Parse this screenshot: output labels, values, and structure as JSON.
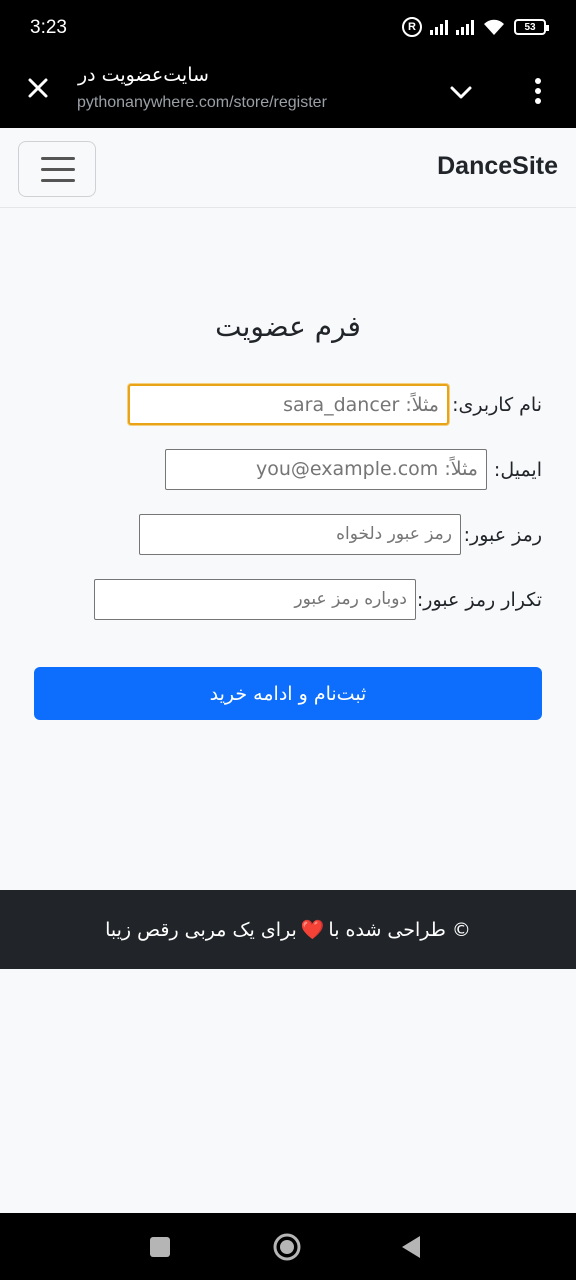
{
  "status_bar": {
    "time": "3:23",
    "battery": "53",
    "r_badge": "R"
  },
  "browser": {
    "title": "سایت‌عضویت در",
    "url": "pythonanywhere.com/store/register"
  },
  "navbar": {
    "brand": "DanceSite"
  },
  "form": {
    "title": "فرم عضویت",
    "username_label": "نام کاربری:",
    "username_placeholder": "مثلاً: sara_dancer",
    "email_label": "ایمیل:",
    "email_placeholder": "مثلاً: you@example.com",
    "password_label": "رمز عبور:",
    "password_placeholder": "رمز عبور دلخواه",
    "password2_label": "تکرار رمز عبور:",
    "password2_placeholder": "دوباره رمز عبور",
    "submit_label": "ثبت‌نام و ادامه خرید"
  },
  "footer": {
    "prefix": "© طراحی شده با",
    "heart": "❤️",
    "suffix": "برای یک مربی رقص زیبا"
  }
}
